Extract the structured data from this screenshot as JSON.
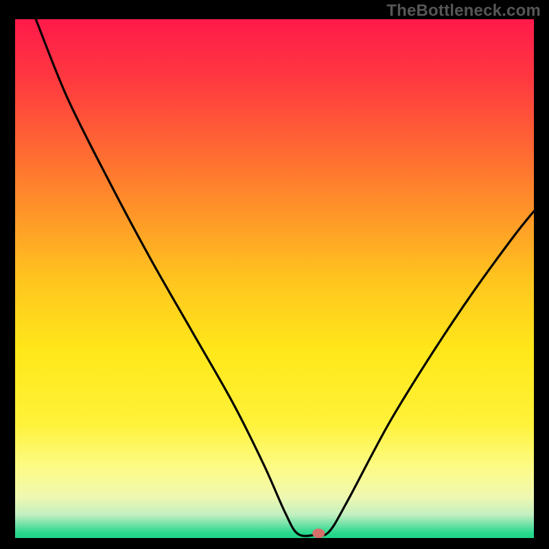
{
  "watermark": "TheBottleneck.com",
  "chart_data": {
    "type": "line",
    "title": "",
    "xlabel": "",
    "ylabel": "",
    "xlim": [
      0,
      100
    ],
    "ylim": [
      0,
      100
    ],
    "grid": false,
    "legend": false,
    "gradient_stops": [
      {
        "offset": 0.0,
        "color": "#ff1a4b"
      },
      {
        "offset": 0.12,
        "color": "#ff3a3f"
      },
      {
        "offset": 0.3,
        "color": "#ff7a2e"
      },
      {
        "offset": 0.5,
        "color": "#ffc41f"
      },
      {
        "offset": 0.64,
        "color": "#ffe81a"
      },
      {
        "offset": 0.78,
        "color": "#fff23a"
      },
      {
        "offset": 0.86,
        "color": "#fdfb83"
      },
      {
        "offset": 0.92,
        "color": "#f0f8b0"
      },
      {
        "offset": 0.955,
        "color": "#c2f0c0"
      },
      {
        "offset": 0.975,
        "color": "#6de0a6"
      },
      {
        "offset": 0.99,
        "color": "#29d98c"
      },
      {
        "offset": 1.0,
        "color": "#1fd488"
      }
    ],
    "series": [
      {
        "name": "bottleneck-curve",
        "points": [
          {
            "x": 4.0,
            "y": 100.0
          },
          {
            "x": 10.0,
            "y": 85.0
          },
          {
            "x": 18.0,
            "y": 69.0
          },
          {
            "x": 26.0,
            "y": 54.0
          },
          {
            "x": 34.0,
            "y": 40.0
          },
          {
            "x": 42.0,
            "y": 26.0
          },
          {
            "x": 48.0,
            "y": 14.0
          },
          {
            "x": 52.0,
            "y": 5.0
          },
          {
            "x": 54.5,
            "y": 0.8
          },
          {
            "x": 58.0,
            "y": 0.6
          },
          {
            "x": 60.5,
            "y": 1.2
          },
          {
            "x": 64.0,
            "y": 7.0
          },
          {
            "x": 72.0,
            "y": 22.0
          },
          {
            "x": 80.0,
            "y": 35.0
          },
          {
            "x": 88.0,
            "y": 47.0
          },
          {
            "x": 96.0,
            "y": 58.0
          },
          {
            "x": 100.0,
            "y": 63.0
          }
        ]
      }
    ],
    "marker": {
      "x": 58.5,
      "y": 0.9,
      "color": "#d66f6a"
    }
  }
}
